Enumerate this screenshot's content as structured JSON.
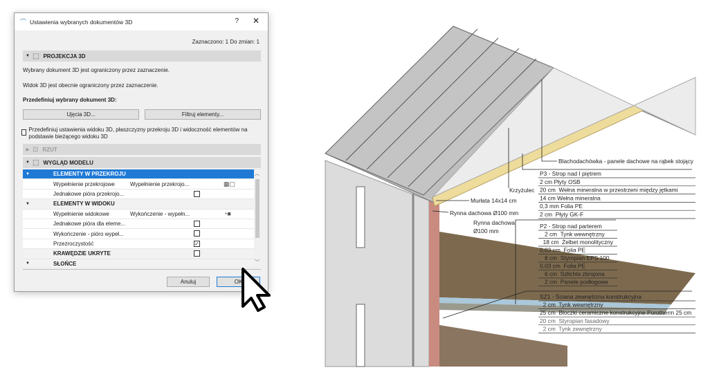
{
  "dialog": {
    "title": "Ustawienia wybranych dokumentów 3D",
    "help": "?",
    "close": "✕",
    "status": "Zaznaczono: 1 Do zmian: 1",
    "projection": {
      "header": "PROJEKCJA 3D",
      "info1": "Wybrany dokument 3D jest ograniczony przez zaznaczenie.",
      "info2": "Widok 3D jest obecnie ograniczony przez zaznaczenie.",
      "redefine_label": "Przedefiniuj wybrany dokument 3D:",
      "btn_views": "Ujęcia 3D...",
      "btn_filter": "Filtruj elementy...",
      "checkbox_label": "Przedefiniuj ustawienia widoku 3D, płaszczyzny przekroju 3D i widoczność elementów na podstawie bieżącego widoku 3D",
      "checkbox_checked": false
    },
    "plan_header": "RZUT",
    "model_header": "WYGLĄD MODELU",
    "rows": [
      {
        "type": "sel",
        "name": "ELEMENTY W PRZEKROJU"
      },
      {
        "type": "item",
        "name": "Wypełnienie przekrojowe",
        "value": "Wypełnienie przekrojo...",
        "icons": "▦▢"
      },
      {
        "type": "item",
        "name": "Jednakowe pióra przekrojo...",
        "checkbox": false
      },
      {
        "type": "grp",
        "name": "ELEMENTY W WIDOKU"
      },
      {
        "type": "item",
        "name": "Wypełnienie widokowe",
        "value": "Wykończenie - wypełn...",
        "icons": "◔■"
      },
      {
        "type": "item",
        "name": "Jednakowe pióra dla eleme...",
        "checkbox": false
      },
      {
        "type": "item",
        "name": "Wykończenie - pióro wypeł...",
        "checkbox": false
      },
      {
        "type": "item",
        "name": "Przezroczystość",
        "checkbox": true
      },
      {
        "type": "grpnt",
        "name": "KRAWĘDZIE UKRYTE",
        "checkbox": false
      },
      {
        "type": "grp",
        "name": "SŁOŃCE"
      }
    ],
    "cancel": "Anuluj",
    "ok": "OK"
  },
  "drawing": {
    "roof_label": "Blachodachówka - panele dachowe na rąbek stojący",
    "brace_label": "Krzyżulec",
    "wallplate_label": "Murłata 14x14 cm",
    "gutter1_label": "Rynna dachowa Ø100 mm",
    "gutter2_label1": "Rynna dachowa",
    "gutter2_label2": "Ø100 mm",
    "p3": [
      "P3 - Strop nad I piętrem",
      "2 cm Płyty OSB",
      "20 cm  Wełna mineralna w przestrzeni między jętkami",
      "14 cm Wełna mineralna",
      "0,3 mm Folia PE",
      "2 cm  Płyty GK-F"
    ],
    "p2": [
      "P2 - Strop nad parterem",
      "   2 cm  Tynk wewnętrzny",
      "  18 cm  Żelbet monolityczny",
      "0,03 cm  Folia PE",
      "   8 cm  Styropian EPS 100",
      "0,03 cm  Folia PE",
      "   6 cm  Szlichta zbrojona",
      "   2 cm  Panele podłogowe"
    ],
    "sz1": [
      "SZ1 - Ściana zewnętrzna konstrukcyjna",
      "  2 cm  Tynk wewnętrzny",
      "25 cm  Bloczki ceramiczne konstrukcyjne Porotherm 25 cm",
      "20 cm  Styropian fasadowy",
      "  2 cm  Tynk zewnętrzny"
    ]
  }
}
